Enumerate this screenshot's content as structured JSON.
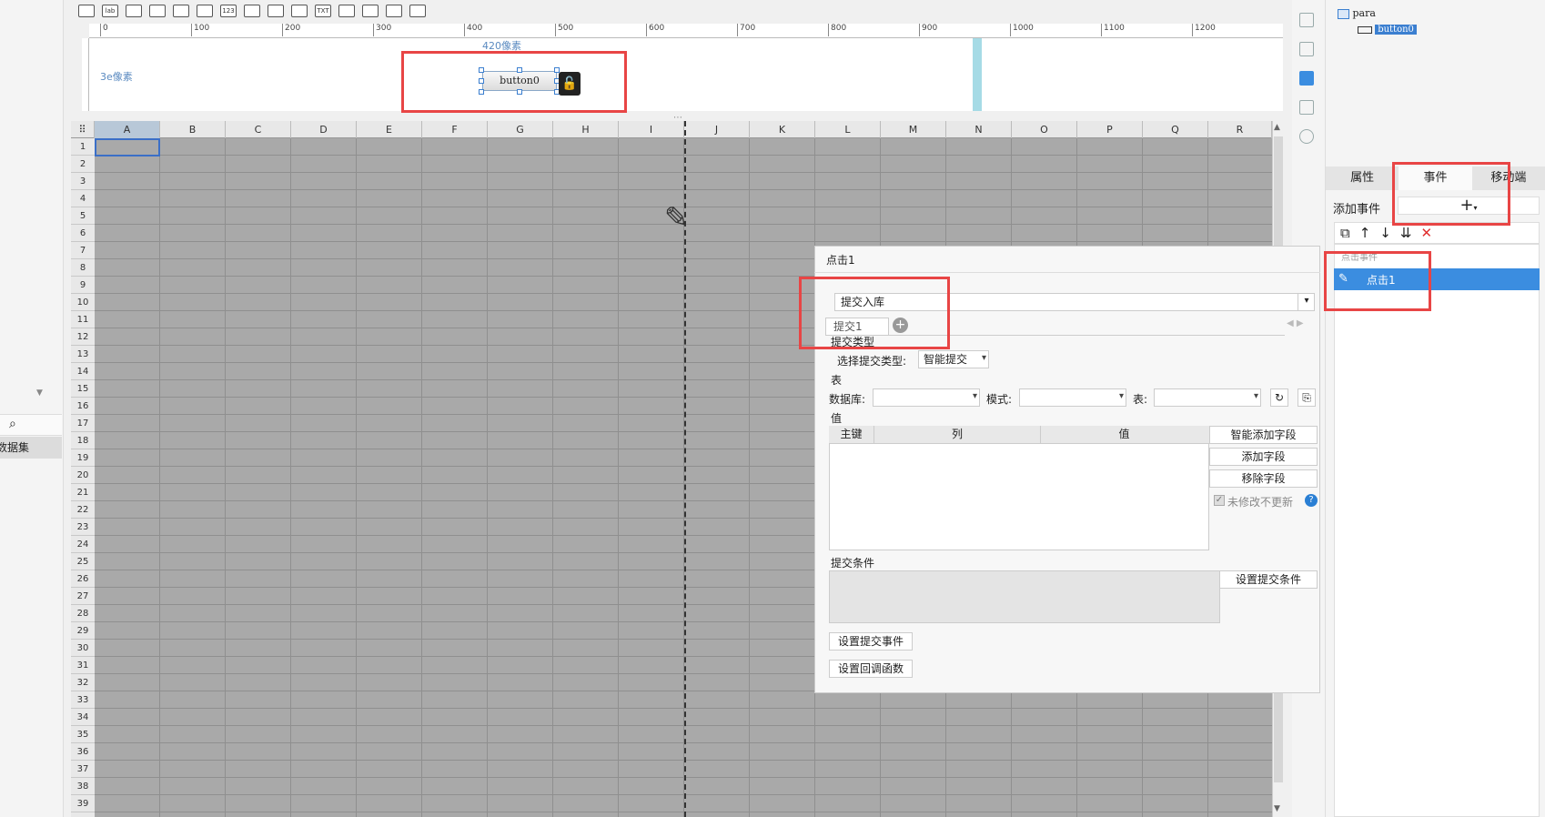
{
  "toolbar": {
    "icons": [
      "textfield-icon",
      "label-icon",
      "button-icon",
      "combo-icon",
      "form-icon",
      "table-icon",
      "number-icon",
      "textarea-icon",
      "checkbox-icon",
      "checklist-icon",
      "text-icon",
      "layout-icon",
      "radio-icon",
      "tree-icon",
      "more-icon"
    ],
    "label_icon_text": "lab",
    "number_icon_text": "123",
    "text_icon_text": "TXT"
  },
  "ruler": {
    "ticks": [
      "0",
      "100",
      "200",
      "300",
      "400",
      "500",
      "600",
      "700",
      "800",
      "900",
      "1000",
      "1100",
      "1200"
    ]
  },
  "canvas": {
    "width_label": "420像素",
    "height_label": "3e像素",
    "widget_label": "button0"
  },
  "sheet": {
    "columns": [
      "A",
      "B",
      "C",
      "D",
      "E",
      "F",
      "G",
      "H",
      "I",
      "J",
      "K",
      "L",
      "M",
      "N",
      "O",
      "P",
      "Q",
      "R"
    ],
    "rows": [
      "1",
      "2",
      "3",
      "4",
      "5",
      "6",
      "7",
      "8",
      "9",
      "10",
      "11",
      "12",
      "13",
      "14",
      "15",
      "16",
      "17",
      "18",
      "19",
      "20",
      "21",
      "22",
      "23",
      "24",
      "25",
      "26",
      "27",
      "28",
      "29",
      "30",
      "31",
      "32",
      "33",
      "34",
      "35",
      "36",
      "37",
      "38",
      "39"
    ]
  },
  "left_panel": {
    "dataset_label": "数据集"
  },
  "tree": {
    "root": "para",
    "child": "button0"
  },
  "right_tabs": [
    "属性",
    "事件",
    "移动端"
  ],
  "right_active_tab": 1,
  "events": {
    "add_label": "添加事件",
    "add_button": "+",
    "group_label": "点击事件",
    "item_label": "点击1"
  },
  "dialog": {
    "title": "点击1",
    "action": "提交入库",
    "subtab": "提交1",
    "submit_type_section": "提交类型",
    "select_type_label": "选择提交类型:",
    "select_type_value": "智能提交",
    "table_section": "表",
    "db_label": "数据库:",
    "schema_label": "模式:",
    "table_label": "表:",
    "value_section": "值",
    "value_columns": [
      "主键",
      "列",
      "值"
    ],
    "smart_add": "智能添加字段",
    "add_field": "添加字段",
    "remove_field": "移除字段",
    "no_update_label": "未修改不更新",
    "condition_section": "提交条件",
    "set_condition": "设置提交条件",
    "set_submit_event": "设置提交事件",
    "set_callback": "设置回调函数"
  },
  "colors": {
    "highlight_red": "#e84545",
    "selection_blue": "#3b8de0",
    "sheet_gray": "#a9a9a9"
  }
}
